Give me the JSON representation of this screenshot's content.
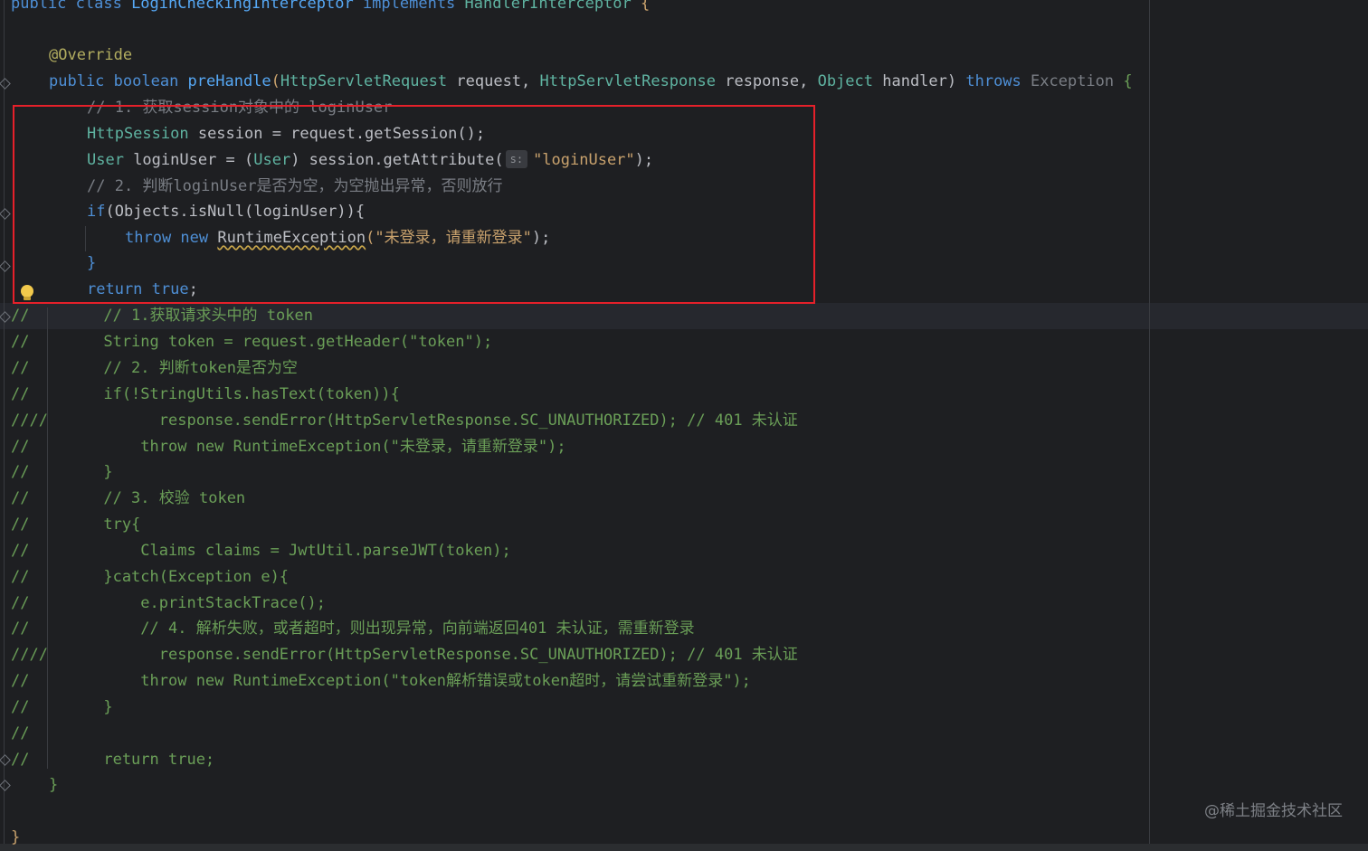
{
  "editor": {
    "header_line": {
      "prefix": "public class ",
      "class_name": "LoginCheckingInterceptor",
      "implements": " implements ",
      "iface": "HandlerInterceptor",
      "brace": " {"
    },
    "override": "@Override",
    "method": {
      "public": "public ",
      "boolean": "boolean ",
      "name": "preHandle",
      "open": "(",
      "t1": "HttpServletRequest",
      "p1": " request, ",
      "t2": "HttpServletResponse",
      "p2": " response, ",
      "t3": "Object",
      "p3": " handler) ",
      "throws": "throws ",
      "exc": "Exception",
      "brace": " {"
    },
    "box": {
      "c1": "// 1. 获取session对象中的 loginUser",
      "l2_type": "HttpSession",
      "l2_rest": " session = request.getSession();",
      "l3_type": "User",
      "l3_rest1": " loginUser = (",
      "l3_cast": "User",
      "l3_rest2": ") session.getAttribute(",
      "l3_hint": "s:",
      "l3_str": "\"loginUser\"",
      "l3_end": ");",
      "c4": "// 2. 判断loginUser是否为空，为空抛出异常，否则放行",
      "l5_if": "if",
      "l5_rest": "(Objects.isNull(loginUser)){",
      "l6_throw": "throw ",
      "l6_new": "new ",
      "l6_cls": "RuntimeException",
      "l6_open": "(",
      "l6_str": "\"未登录，请重新登录\"",
      "l6_end": ");",
      "l7": "}",
      "l8_ret": "return ",
      "l8_true": "true",
      "l8_end": ";"
    },
    "commented": [
      "//        // 1.获取请求头中的 token",
      "//        String token = request.getHeader(\"token\");",
      "//        // 2. 判断token是否为空",
      "//        if(!StringUtils.hasText(token)){",
      "////            response.sendError(HttpServletResponse.SC_UNAUTHORIZED); // 401 未认证",
      "//            throw new RuntimeException(\"未登录，请重新登录\");",
      "//        }",
      "//        // 3. 校验 token",
      "//        try{",
      "//            Claims claims = JwtUtil.parseJWT(token);",
      "//        }catch(Exception e){",
      "//            e.printStackTrace();",
      "//            // 4. 解析失败，或者超时，则出现异常，向前端返回401 未认证，需重新登录",
      "////            response.sendError(HttpServletResponse.SC_UNAUTHORIZED); // 401 未认证",
      "//            throw new RuntimeException(\"token解析错误或token超时，请尝试重新登录\");",
      "//        }",
      "//",
      "//        return true;"
    ],
    "method_close": "}",
    "class_close": "}"
  },
  "watermark": "@稀土掘金技术社区",
  "colors": {
    "highlight_box": "#e5202a",
    "background": "#1e1f22"
  }
}
